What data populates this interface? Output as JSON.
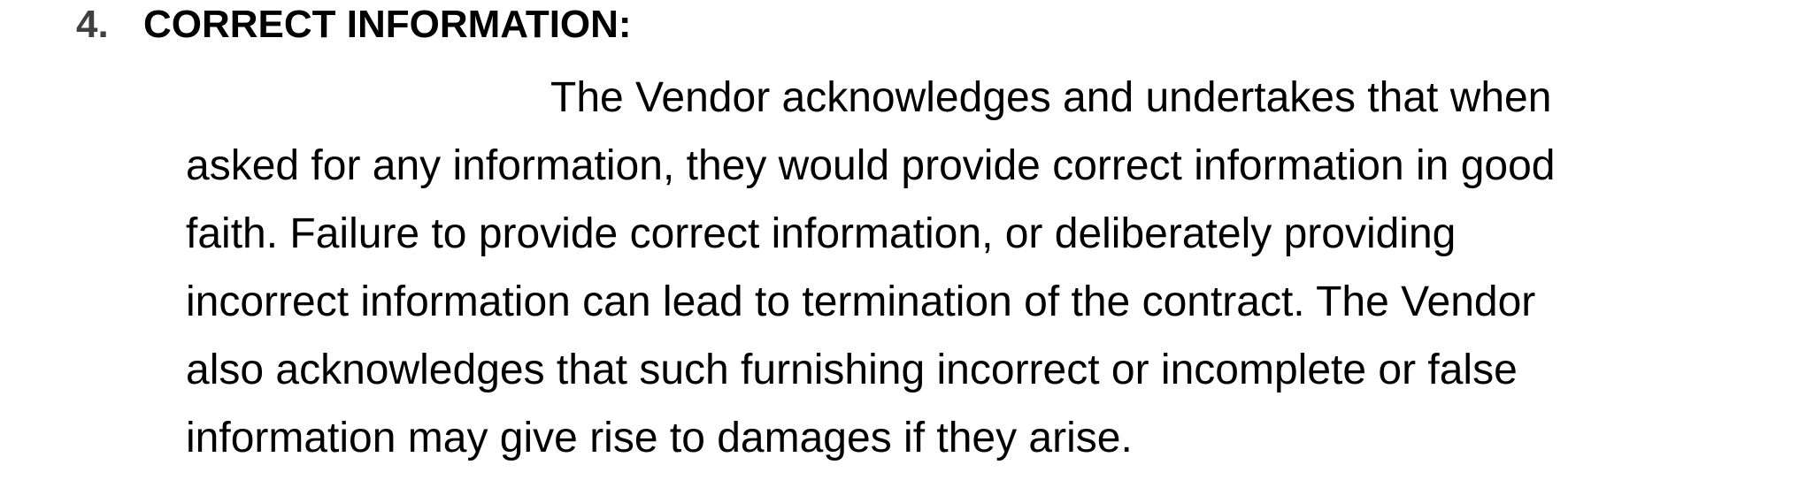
{
  "clause": {
    "number": "4.",
    "title": "CORRECT INFORMATION:",
    "lines": [
      "The Vendor acknowledges and undertakes that when",
      "asked for any information, they would provide correct information in good",
      "faith. Failure to provide correct information, or deliberately providing",
      "incorrect information can lead to termination of the contract. The Vendor",
      "also acknowledges that such furnishing incorrect or incomplete or false",
      "information may give rise to damages if they arise."
    ]
  }
}
